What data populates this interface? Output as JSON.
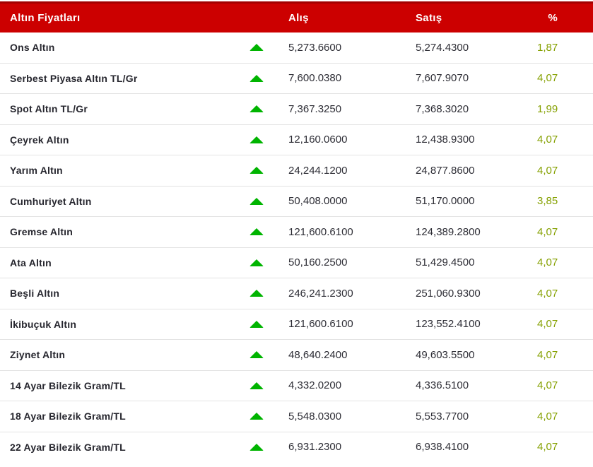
{
  "table": {
    "title": "Altın Fiyatları",
    "columns": {
      "buy": "Alış",
      "sell": "Satış",
      "change": "%"
    },
    "rows": [
      {
        "name": "Ons Altın",
        "direction": "up",
        "buy": "5,273.6600",
        "sell": "5,274.4300",
        "change": "1,87"
      },
      {
        "name": "Serbest Piyasa Altın TL/Gr",
        "direction": "up",
        "buy": "7,600.0380",
        "sell": "7,607.9070",
        "change": "4,07"
      },
      {
        "name": "Spot Altın TL/Gr",
        "direction": "up",
        "buy": "7,367.3250",
        "sell": "7,368.3020",
        "change": "1,99"
      },
      {
        "name": "Çeyrek Altın",
        "direction": "up",
        "buy": "12,160.0600",
        "sell": "12,438.9300",
        "change": "4,07"
      },
      {
        "name": "Yarım Altın",
        "direction": "up",
        "buy": "24,244.1200",
        "sell": "24,877.8600",
        "change": "4,07"
      },
      {
        "name": "Cumhuriyet Altın",
        "direction": "up",
        "buy": "50,408.0000",
        "sell": "51,170.0000",
        "change": "3,85"
      },
      {
        "name": "Gremse Altın",
        "direction": "up",
        "buy": "121,600.6100",
        "sell": "124,389.2800",
        "change": "4,07"
      },
      {
        "name": "Ata Altın",
        "direction": "up",
        "buy": "50,160.2500",
        "sell": "51,429.4500",
        "change": "4,07"
      },
      {
        "name": "Beşli Altın",
        "direction": "up",
        "buy": "246,241.2300",
        "sell": "251,060.9300",
        "change": "4,07"
      },
      {
        "name": "İkibuçuk Altın",
        "direction": "up",
        "buy": "121,600.6100",
        "sell": "123,552.4100",
        "change": "4,07"
      },
      {
        "name": "Ziynet Altın",
        "direction": "up",
        "buy": "48,640.2400",
        "sell": "49,603.5500",
        "change": "4,07"
      },
      {
        "name": "14 Ayar Bilezik Gram/TL",
        "direction": "up",
        "buy": "4,332.0200",
        "sell": "4,336.5100",
        "change": "4,07"
      },
      {
        "name": "18 Ayar Bilezik Gram/TL",
        "direction": "up",
        "buy": "5,548.0300",
        "sell": "5,553.7700",
        "change": "4,07"
      },
      {
        "name": "22 Ayar Bilezik Gram/TL",
        "direction": "up",
        "buy": "6,931.2300",
        "sell": "6,938.4100",
        "change": "4,07"
      }
    ],
    "colors": {
      "header_bg": "#cc0000",
      "header_top_border": "#a30000",
      "up_arrow_green": "#00b400",
      "change_olive": "#85a000",
      "row_separator": "#e3e3e3"
    },
    "icons": {
      "up_arrow": "up-arrow-icon"
    }
  }
}
